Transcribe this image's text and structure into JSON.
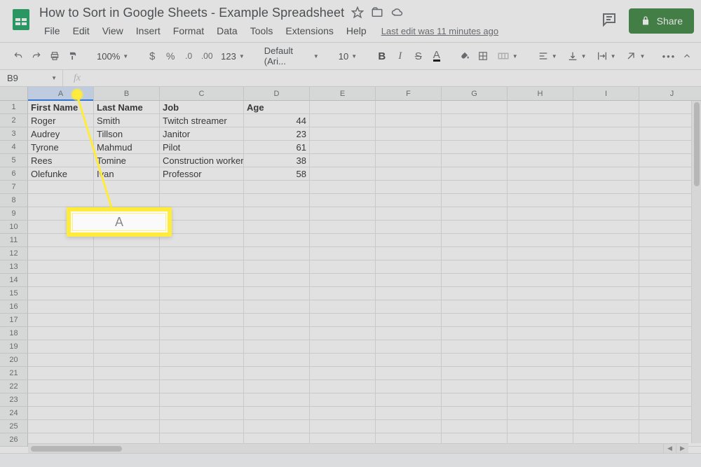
{
  "doc": {
    "title": "How to Sort in Google Sheets - Example Spreadsheet",
    "menus": [
      "File",
      "Edit",
      "View",
      "Insert",
      "Format",
      "Data",
      "Tools",
      "Extensions",
      "Help"
    ],
    "last_edit": "Last edit was 11 minutes ago",
    "share_label": "Share"
  },
  "toolbar": {
    "zoom": "100%",
    "font": "Default (Ari...",
    "font_size": "10",
    "more_formats": "123"
  },
  "fx": {
    "name_box": "B9",
    "formula": ""
  },
  "grid": {
    "columns": [
      "A",
      "B",
      "C",
      "D",
      "E",
      "F",
      "G",
      "H",
      "I",
      "J"
    ],
    "selected_col": "A",
    "row_count": 26,
    "headers": [
      "First Name",
      "Last Name",
      "Job",
      "Age"
    ],
    "rows": [
      {
        "first": "Roger",
        "last": "Smith",
        "job": "Twitch streamer",
        "age": 44
      },
      {
        "first": "Audrey",
        "last": "Tillson",
        "job": "Janitor",
        "age": 23
      },
      {
        "first": "Tyrone",
        "last": "Mahmud",
        "job": "Pilot",
        "age": 61
      },
      {
        "first": "Rees",
        "last": "Tomine",
        "job": "Construction worker",
        "age": 38
      },
      {
        "first": "Olefunke",
        "last": "Ivan",
        "job": "Professor",
        "age": 58
      }
    ]
  },
  "callout": {
    "label": "A"
  }
}
